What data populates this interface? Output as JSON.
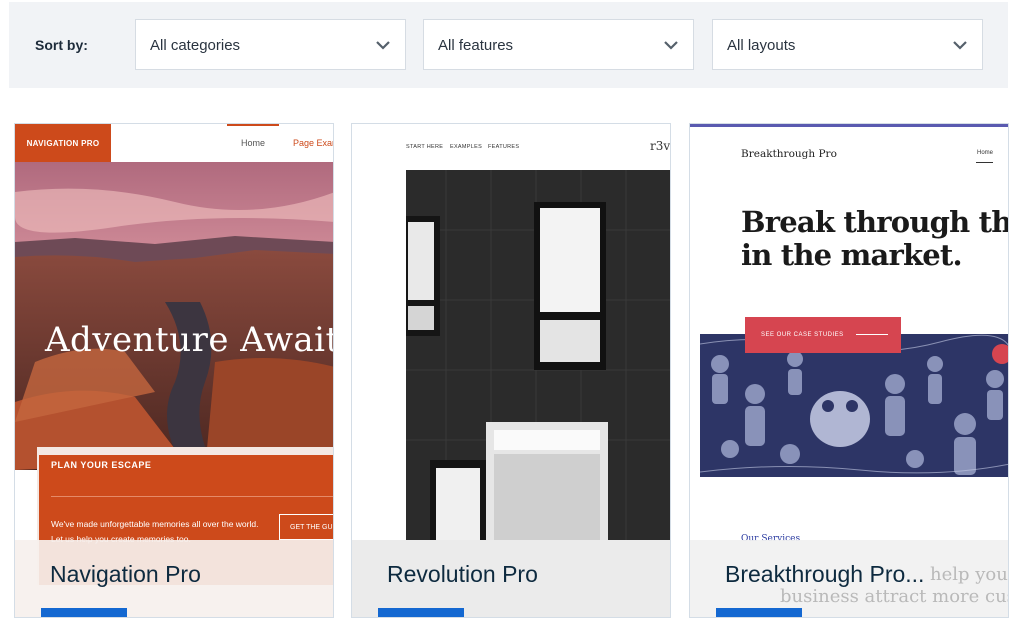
{
  "filters": {
    "sort_label": "Sort by:",
    "categories": "All categories",
    "features": "All features",
    "layouts": "All layouts"
  },
  "cards": [
    {
      "title": "Navigation Pro",
      "preview": {
        "logo": "NAVIGATION PRO",
        "nav_home": "Home",
        "nav_page": "Page Exam",
        "headline": "Adventure Await",
        "box_heading": "PLAN YOUR ESCAPE",
        "box_text": "We've made unforgettable memories all over the world. Let us help you create memories too.",
        "box_button": "GET THE GU"
      }
    },
    {
      "title": "Revolution Pro",
      "preview": {
        "nav_start": "START HERE",
        "nav_examples": "EXAMPLES",
        "nav_features": "FEATURES",
        "logo": "r3v"
      }
    },
    {
      "title": "Breakthrough Pro...",
      "preview": {
        "brand": "Breakthrough Pro",
        "nav_home": "Home",
        "headline_1": "Break through the n",
        "headline_2": "in the market.",
        "button": "SEE OUR CASE STUDIES",
        "services": "Our Services",
        "tagline_1": "help your",
        "tagline_2": "business attract more customer"
      }
    }
  ],
  "colors": {
    "accent_bar": "#1468d1",
    "nav_pro_orange": "#cd4a1b",
    "breakthrough_red": "#d64550",
    "breakthrough_navy": "#2d3566"
  }
}
